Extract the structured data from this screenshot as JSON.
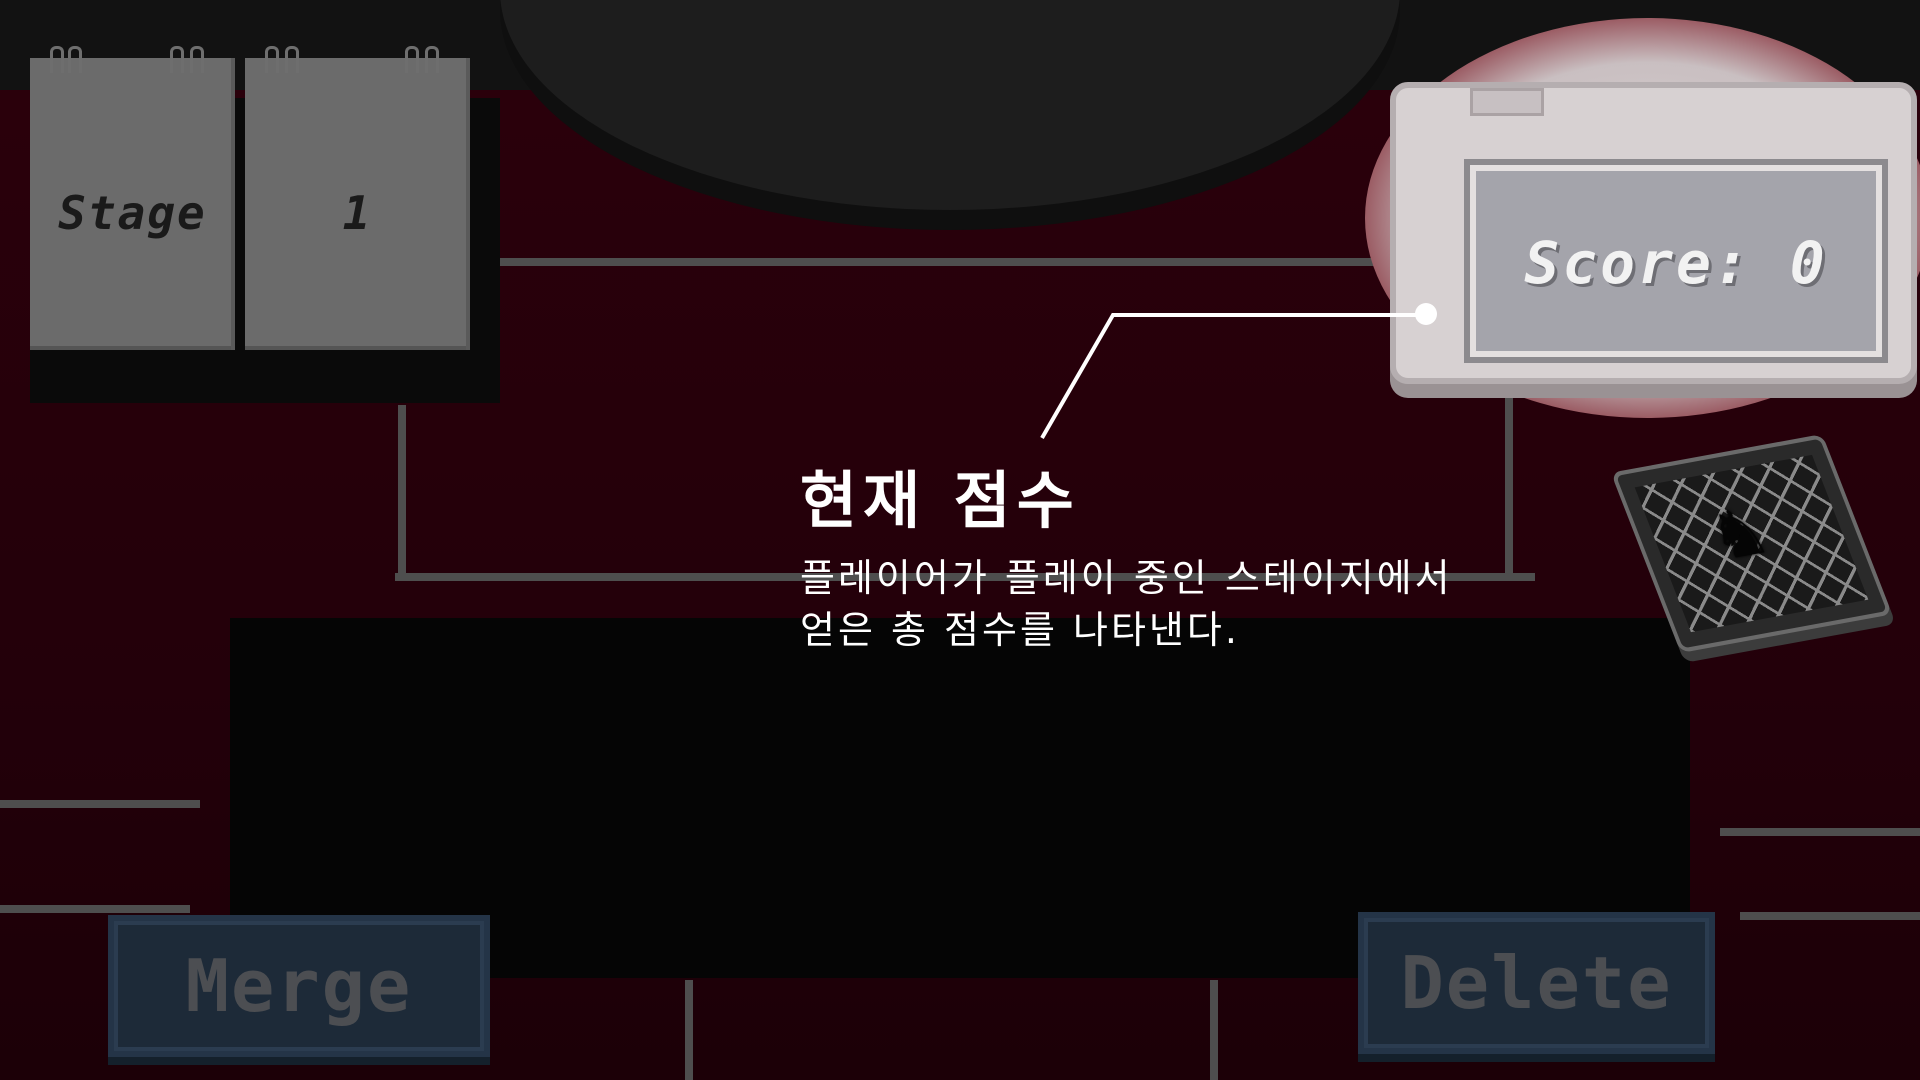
{
  "hud": {
    "stage_label": "Stage",
    "stage_value": "1",
    "score_text": "Score: 0"
  },
  "tutorial": {
    "title": "현재 점수",
    "description_line1": "플레이어가 플레이 중인 스테이지에서",
    "description_line2": "얻은 총 점수를 나타낸다."
  },
  "buttons": {
    "merge_label": "Merge",
    "delete_label": "Delete"
  },
  "icons": {
    "deck": "card-deck-icon",
    "callout": "callout-pointer-icon"
  },
  "colors": {
    "felt": "#23000a",
    "button_bg": "#1d2a38",
    "button_text": "#4c4e52",
    "score_screen": "#a4a4ab",
    "callout": "#ffffff"
  }
}
